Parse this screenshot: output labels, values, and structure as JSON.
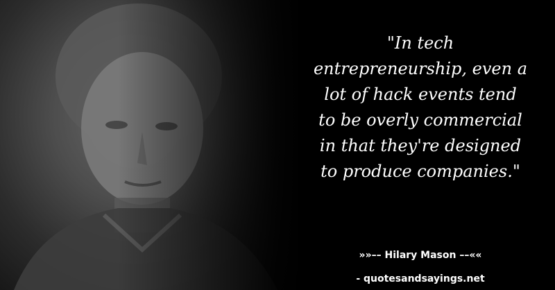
{
  "quote": {
    "lines": [
      "\"In tech",
      "entrepreneurship, even a",
      "lot of hack events tend",
      "to be overly commercial",
      "in that they're designed",
      "to produce companies.\""
    ]
  },
  "author": {
    "text": "»»–– Hilary Mason ––««"
  },
  "site": {
    "text": "- quotesandsayings.net"
  }
}
